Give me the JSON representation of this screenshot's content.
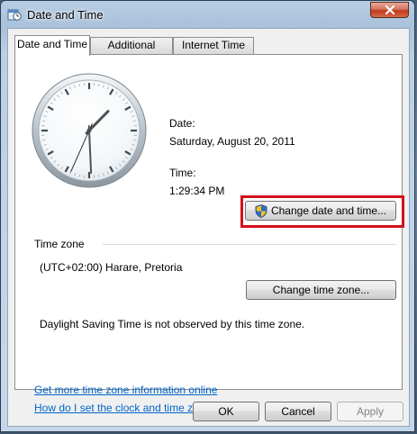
{
  "window": {
    "title": "Date and Time",
    "title_icon": "date-time-icon",
    "close_icon": "close-icon"
  },
  "tabs": [
    {
      "label": "Date and Time",
      "active": true
    },
    {
      "label": "Additional Clocks",
      "active": false
    },
    {
      "label": "Internet Time",
      "active": false
    }
  ],
  "clock": {
    "hour": 1,
    "minute": 29,
    "second": 34
  },
  "date": {
    "label": "Date:",
    "value": "Saturday, August 20, 2011"
  },
  "time": {
    "label": "Time:",
    "value": "1:29:34 PM"
  },
  "buttons": {
    "change_date_time": "Change date and time...",
    "change_time_zone": "Change time zone...",
    "ok": "OK",
    "cancel": "Cancel",
    "apply": "Apply"
  },
  "time_zone": {
    "group_label": "Time zone",
    "value": "(UTC+02:00) Harare, Pretoria",
    "dst_note": "Daylight Saving Time is not observed by this time zone."
  },
  "links": {
    "more_info": "Get more time zone information online",
    "how_to": "How do I set the clock and time zone?"
  },
  "colors": {
    "highlight": "#d2101b",
    "link": "#0066cc"
  }
}
